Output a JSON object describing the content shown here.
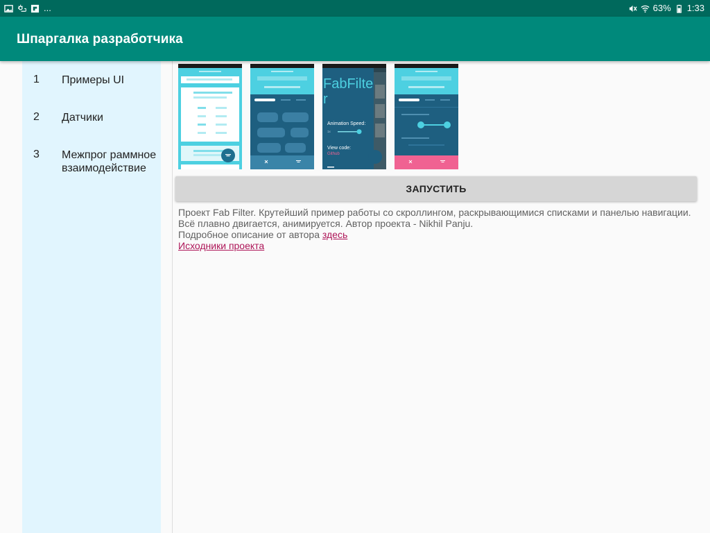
{
  "status_bar": {
    "left_icons": [
      "image-icon",
      "weather-icon",
      "flipboard-icon"
    ],
    "more": "...",
    "battery": "63%",
    "time": "1:33"
  },
  "app_bar": {
    "title": "Шпаргалка разработчика"
  },
  "sidebar": {
    "items": [
      {
        "num": "1",
        "label": "Примеры UI"
      },
      {
        "num": "2",
        "label": "Датчики"
      },
      {
        "num": "3",
        "label": "Межпрог раммное взаимодействие"
      }
    ]
  },
  "preview": {
    "shot3_title": "FabFilte r",
    "shot3_speed_label": "Animation Speed:",
    "shot3_view_label": "View code:",
    "shot3_view_link": "Github"
  },
  "run_button": {
    "label": "ЗАПУСТИТЬ"
  },
  "description": {
    "line1": "Проект Fab Filter. Крутейший пример работы со скроллингом, раскрывающимися списками и панелью навигации.",
    "line2": "Всё плавно двигается, анимируется. Автор проекта - Nikhil Panju.",
    "line3_prefix": "Подробное описание от автора ",
    "line3_link": "здесь",
    "source_link": "Исходники проекта"
  },
  "colors": {
    "status_bar": "#00695c",
    "app_bar": "#00897b",
    "sidebar_bg": "#e1f5fe",
    "link": "#ad1457",
    "preview_teal": "#4dd0e1",
    "preview_dark": "#1e5f80",
    "preview_pink": "#f06292"
  }
}
